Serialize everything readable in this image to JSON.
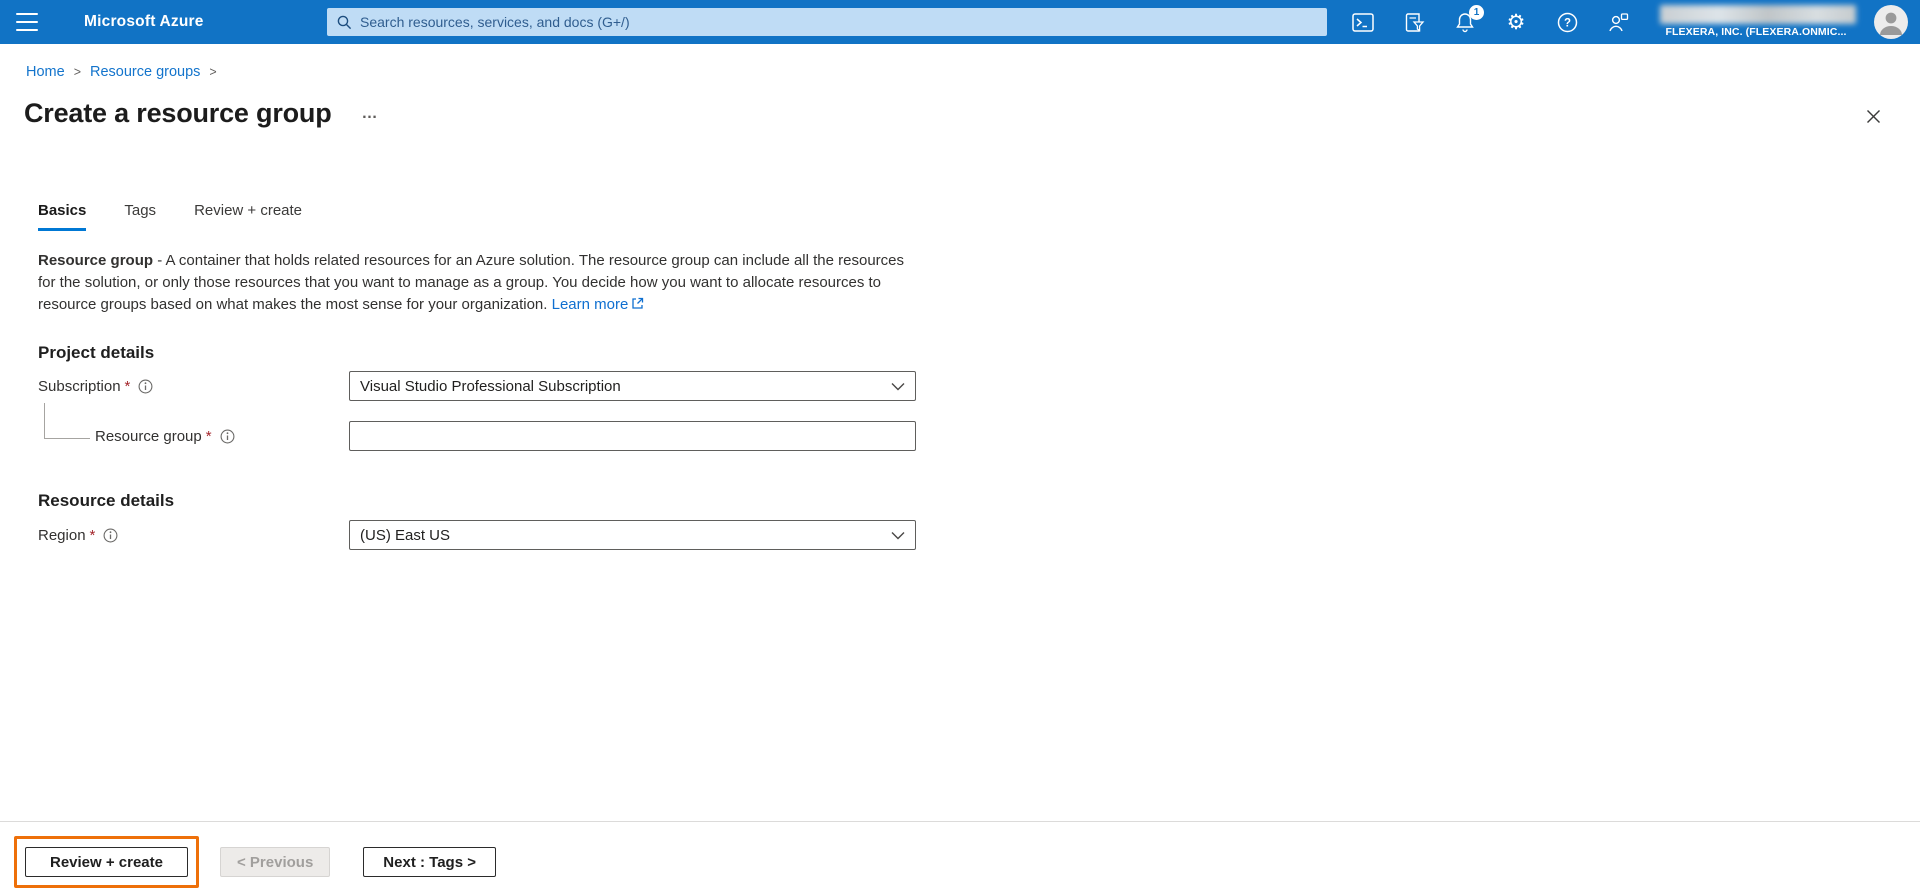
{
  "colors": {
    "topbar_bg": "#1173c5",
    "accent": "#0078d4",
    "link": "#1374cc",
    "required_marker": "#a4262c",
    "highlight_annotation": "#ee7009",
    "search_bg": "#bfdcf5"
  },
  "topbar": {
    "product": "Microsoft Azure",
    "search_placeholder": "Search resources, services, and docs (G+/)",
    "notification_badge": "1",
    "tenant": "FLEXERA, INC. (FLEXERA.ONMIC..."
  },
  "breadcrumb": {
    "separator": ">",
    "items": [
      {
        "label": "Home"
      },
      {
        "label": "Resource groups"
      }
    ]
  },
  "page": {
    "title": "Create a resource group",
    "more": "…"
  },
  "tabs": [
    {
      "label": "Basics",
      "active": true
    },
    {
      "label": "Tags",
      "active": false
    },
    {
      "label": "Review + create",
      "active": false
    }
  ],
  "description": {
    "lead": "Resource group",
    "body": " - A container that holds related resources for an Azure solution. The resource group can include all the resources for the solution, or only those resources that you want to manage as a group. You decide how you want to allocate resources to resource groups based on what makes the most sense for your organization. ",
    "link": "Learn more"
  },
  "form": {
    "required_marker": "*",
    "project": {
      "heading": "Project details",
      "subscription": {
        "label": "Subscription",
        "value": "Visual Studio Professional Subscription"
      },
      "resource_group": {
        "label": "Resource group",
        "value": ""
      }
    },
    "resource": {
      "heading": "Resource details",
      "region": {
        "label": "Region",
        "value": "(US) East US"
      }
    }
  },
  "footer": {
    "review_create": "Review + create",
    "previous": "< Previous",
    "next": "Next : Tags >"
  }
}
